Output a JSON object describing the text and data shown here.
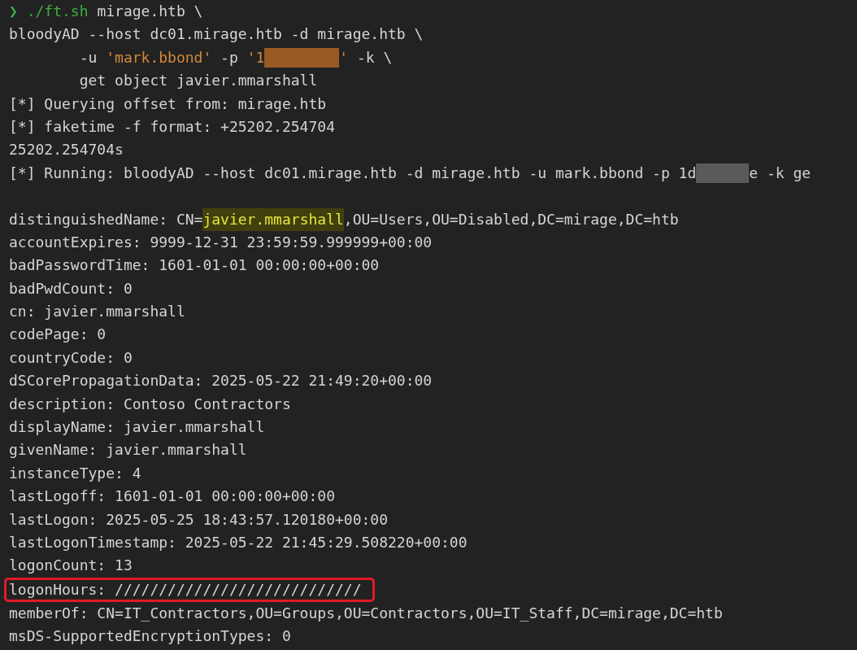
{
  "terminal": {
    "lines": [
      {
        "kind": "text",
        "boxed": false,
        "segments": [
          {
            "kind": "prompt",
            "text": "❯ ./ft.sh"
          },
          {
            "kind": "plain",
            "text": " mirage.htb \\"
          }
        ]
      },
      {
        "kind": "text",
        "boxed": false,
        "segments": [
          {
            "kind": "plain",
            "text": "bloodyAD --host dc01.mirage.htb -d mirage.htb \\"
          }
        ]
      },
      {
        "kind": "text",
        "boxed": false,
        "segments": [
          {
            "kind": "plain",
            "text": "        -u "
          },
          {
            "kind": "string",
            "text": "'mark.bbond'"
          },
          {
            "kind": "plain",
            "text": " -p "
          },
          {
            "kind": "string",
            "text": "'1"
          },
          {
            "kind": "redaction"
          },
          {
            "kind": "string",
            "text": "'"
          },
          {
            "kind": "plain",
            "text": " -k \\"
          }
        ]
      },
      {
        "kind": "text",
        "boxed": false,
        "segments": [
          {
            "kind": "plain",
            "text": "        get object javier.mmarshall"
          }
        ]
      },
      {
        "kind": "text",
        "boxed": false,
        "segments": [
          {
            "kind": "plain",
            "text": "[*] Querying offset from: mirage.htb"
          }
        ]
      },
      {
        "kind": "text",
        "boxed": false,
        "segments": [
          {
            "kind": "plain",
            "text": "[*] faketime -f format: +25202.254704"
          }
        ]
      },
      {
        "kind": "text",
        "boxed": false,
        "segments": [
          {
            "kind": "plain",
            "text": "25202.254704s"
          }
        ]
      },
      {
        "kind": "text",
        "boxed": false,
        "segments": [
          {
            "kind": "plain",
            "text": "[*] Running: bloodyAD --host dc01.mirage.htb -d mirage.htb -u mark.bbond -p 1d"
          },
          {
            "kind": "redaction"
          },
          {
            "kind": "plain",
            "text": "e -k ge"
          }
        ]
      },
      {
        "kind": "blank",
        "boxed": false
      },
      {
        "kind": "text",
        "boxed": false,
        "segments": [
          {
            "kind": "plain",
            "text": "distinguishedName: CN="
          },
          {
            "kind": "highlight",
            "text": "javier.mmarshall"
          },
          {
            "kind": "plain",
            "text": ",OU=Users,OU=Disabled,DC=mirage,DC=htb"
          }
        ]
      },
      {
        "kind": "text",
        "boxed": false,
        "segments": [
          {
            "kind": "plain",
            "text": "accountExpires: 9999-12-31 23:59:59.999999+00:00"
          }
        ]
      },
      {
        "kind": "text",
        "boxed": false,
        "segments": [
          {
            "kind": "plain",
            "text": "badPasswordTime: 1601-01-01 00:00:00+00:00"
          }
        ]
      },
      {
        "kind": "text",
        "boxed": false,
        "segments": [
          {
            "kind": "plain",
            "text": "badPwdCount: 0"
          }
        ]
      },
      {
        "kind": "text",
        "boxed": false,
        "segments": [
          {
            "kind": "plain",
            "text": "cn: javier.mmarshall"
          }
        ]
      },
      {
        "kind": "text",
        "boxed": false,
        "segments": [
          {
            "kind": "plain",
            "text": "codePage: 0"
          }
        ]
      },
      {
        "kind": "text",
        "boxed": false,
        "segments": [
          {
            "kind": "plain",
            "text": "countryCode: 0"
          }
        ]
      },
      {
        "kind": "text",
        "boxed": false,
        "segments": [
          {
            "kind": "plain",
            "text": "dSCorePropagationData: 2025-05-22 21:49:20+00:00"
          }
        ]
      },
      {
        "kind": "text",
        "boxed": false,
        "segments": [
          {
            "kind": "plain",
            "text": "description: Contoso Contractors"
          }
        ]
      },
      {
        "kind": "text",
        "boxed": false,
        "segments": [
          {
            "kind": "plain",
            "text": "displayName: javier.mmarshall"
          }
        ]
      },
      {
        "kind": "text",
        "boxed": false,
        "segments": [
          {
            "kind": "plain",
            "text": "givenName: javier.mmarshall"
          }
        ]
      },
      {
        "kind": "text",
        "boxed": false,
        "segments": [
          {
            "kind": "plain",
            "text": "instanceType: 4"
          }
        ]
      },
      {
        "kind": "text",
        "boxed": false,
        "segments": [
          {
            "kind": "plain",
            "text": "lastLogoff: 1601-01-01 00:00:00+00:00"
          }
        ]
      },
      {
        "kind": "text",
        "boxed": false,
        "segments": [
          {
            "kind": "plain",
            "text": "lastLogon: 2025-05-25 18:43:57.120180+00:00"
          }
        ]
      },
      {
        "kind": "text",
        "boxed": false,
        "segments": [
          {
            "kind": "plain",
            "text": "lastLogonTimestamp: 2025-05-22 21:45:29.508220+00:00"
          }
        ]
      },
      {
        "kind": "text",
        "boxed": false,
        "segments": [
          {
            "kind": "plain",
            "text": "logonCount: 13"
          }
        ]
      },
      {
        "kind": "text",
        "boxed": true,
        "segments": [
          {
            "kind": "plain",
            "text": "logonHours: ////////////////////////////"
          }
        ]
      },
      {
        "kind": "text",
        "boxed": false,
        "segments": [
          {
            "kind": "plain",
            "text": "memberOf: CN=IT_Contractors,OU=Groups,OU=Contractors,OU=IT_Staff,DC=mirage,DC=htb"
          }
        ]
      },
      {
        "kind": "text",
        "boxed": false,
        "segments": [
          {
            "kind": "plain",
            "text": "msDS-SupportedEncryptionTypes: 0"
          }
        ]
      }
    ]
  }
}
